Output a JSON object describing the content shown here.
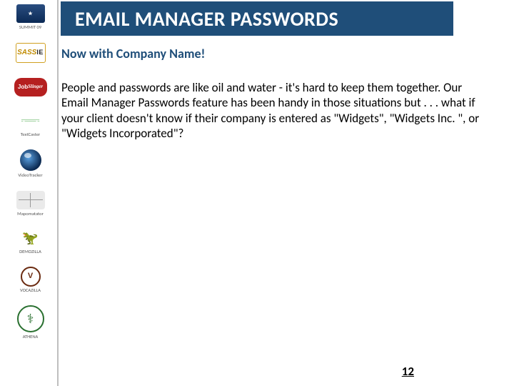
{
  "title": "EMAIL MANAGER PASSWORDS",
  "subheading": "Now with Company Name!",
  "body": "People and passwords are like oil and water - it's hard to keep them together. Our Email Manager Passwords feature has been handy in those situations but . . . what if your client doesn't know if their company is entered as \"Widgets\", \"Widgets Inc. \", or \"Widgets Incorporated\"?",
  "page_number": "12",
  "sidebar": {
    "logos": [
      {
        "name": "summit",
        "caption": "SUMMIT 09"
      },
      {
        "name": "sassie",
        "caption": ""
      },
      {
        "name": "jobslinger",
        "caption": ""
      },
      {
        "name": "textcaster",
        "caption": "TextCaster"
      },
      {
        "name": "videotracker",
        "caption": "VideoTracker"
      },
      {
        "name": "mapomatator",
        "caption": "Mapomatator"
      },
      {
        "name": "demozilla",
        "caption": "DEMOZILLA"
      },
      {
        "name": "vocazilla",
        "caption": "VOCAZILLA"
      },
      {
        "name": "athena",
        "caption": "ATHENA"
      }
    ]
  }
}
